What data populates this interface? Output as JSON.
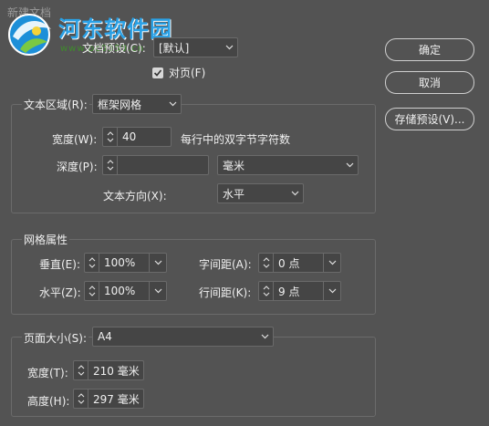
{
  "window": {
    "title": "新建文档"
  },
  "watermark": {
    "site_name": "河东软件园",
    "url": "www.pc0359.cn"
  },
  "preset": {
    "label": "文档预设(C):",
    "value": "[默认]"
  },
  "facing_pages": {
    "label": "对页(F)",
    "checked": true
  },
  "buttons": {
    "ok": "确定",
    "cancel": "取消",
    "save_preset": "存储预设(V)..."
  },
  "text_area": {
    "label": "文本区域(R):",
    "value": "框架网格",
    "width_label": "宽度(W):",
    "width_value": "40",
    "width_unit_text": "每行中的双字节字符数",
    "depth_label": "深度(P):",
    "depth_value": "",
    "depth_unit": "毫米",
    "direction_label": "文本方向(X):",
    "direction_value": "水平"
  },
  "grid": {
    "title": "网格属性",
    "vertical_label": "垂直(E):",
    "vertical_value": "100%",
    "horizontal_label": "水平(Z):",
    "horizontal_value": "100%",
    "char_spacing_label": "字间距(A):",
    "char_spacing_value": "0 点",
    "line_spacing_label": "行间距(K):",
    "line_spacing_value": "9 点"
  },
  "page_size": {
    "label": "页面大小(S):",
    "value": "A4",
    "width_label": "宽度(T):",
    "width_value": "210 毫米",
    "height_label": "高度(H):",
    "height_value": "297 毫米"
  },
  "colors": {
    "background": "#535353",
    "field_bg": "#454545",
    "border": "#6a6a6a",
    "text": "#f0f0f0",
    "watermark_blue": "#2aa1e6",
    "watermark_green": "#3f8b2c"
  }
}
